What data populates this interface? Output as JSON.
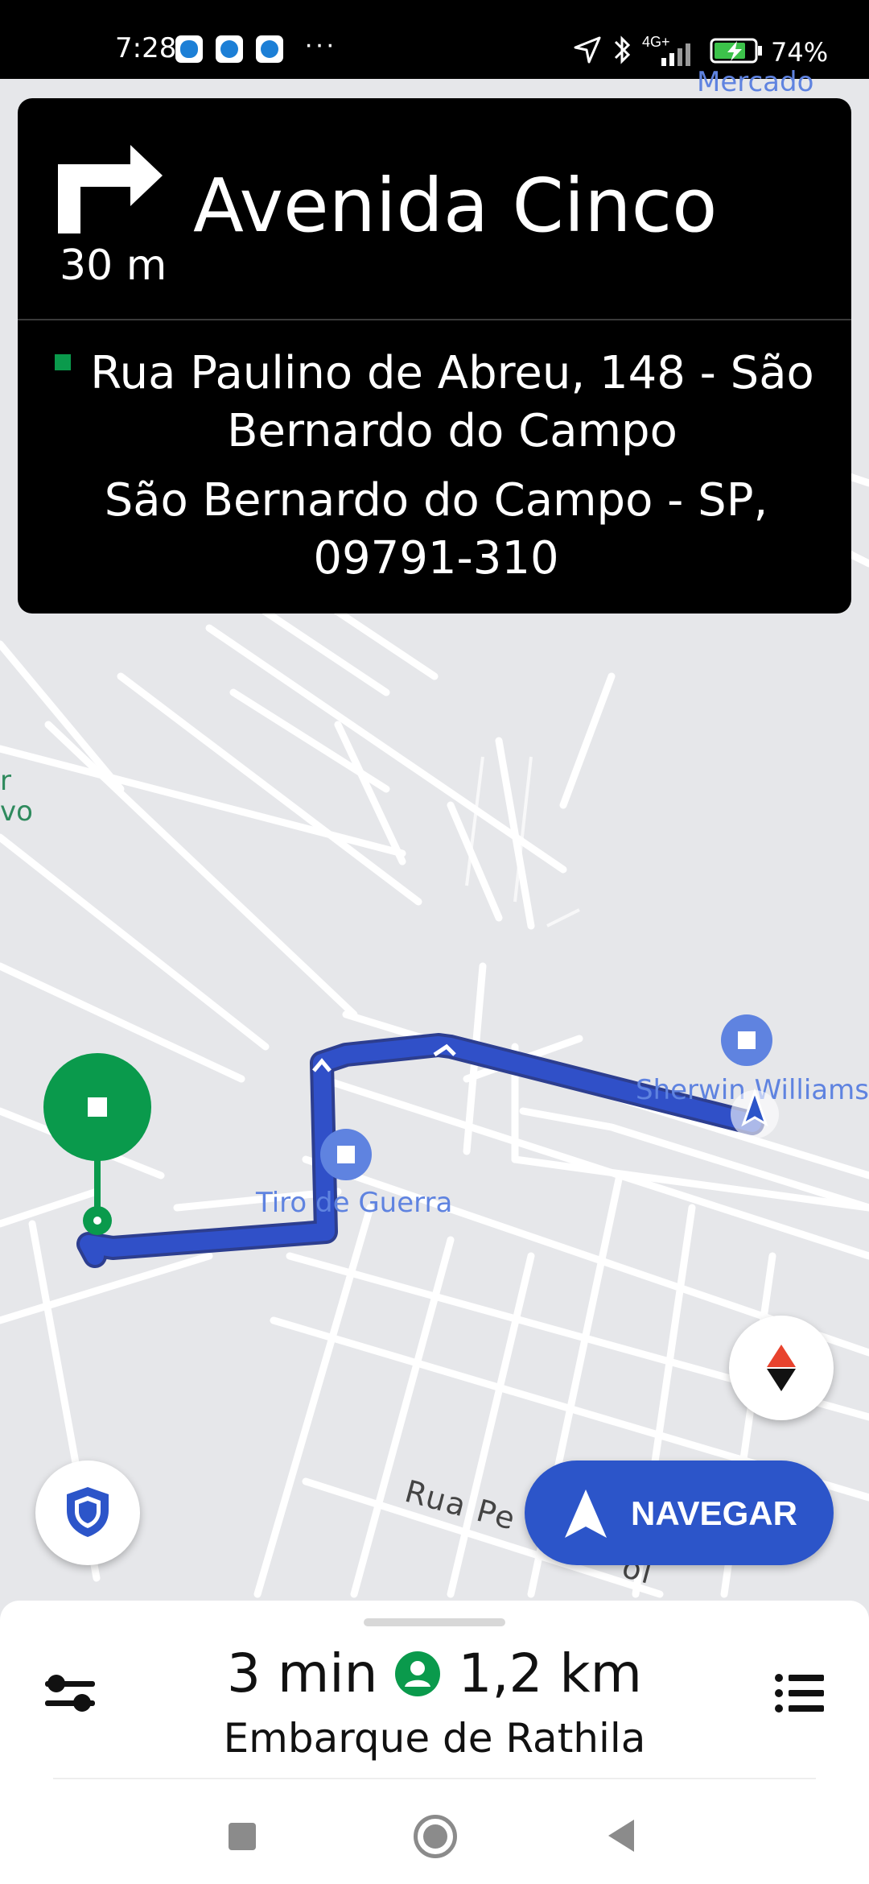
{
  "status_bar": {
    "time": "7:28",
    "dots": "···",
    "network": "4G+",
    "battery": "74%"
  },
  "map": {
    "top_label": "Mercado São",
    "left_label_1": "r",
    "left_label_2": "vo",
    "pois": [
      {
        "name": "Sherwin Williams"
      },
      {
        "name": "Tiro de Guerra"
      }
    ],
    "street_label": "Rua Pe",
    "street_label_tail": "ol"
  },
  "navigation": {
    "turn_icon": "turn-right-icon",
    "distance": "30 m",
    "street": "Avenida Cinco",
    "destination_line1": "Rua Paulino de Abreu, 148 - São Bernardo do Campo",
    "destination_line2": "São Bernardo do Campo - SP, 09791-310"
  },
  "buttons": {
    "navigate_label": "NAVEGAR"
  },
  "trip": {
    "eta": "3 min",
    "distance": "1,2 km",
    "subtitle": "Embarque de Rathila"
  },
  "colors": {
    "route": "#2f4fc7",
    "destination_green": "#0a9a4c",
    "navigate_button": "#2c55c9",
    "poi_blue": "#5f83e0"
  }
}
